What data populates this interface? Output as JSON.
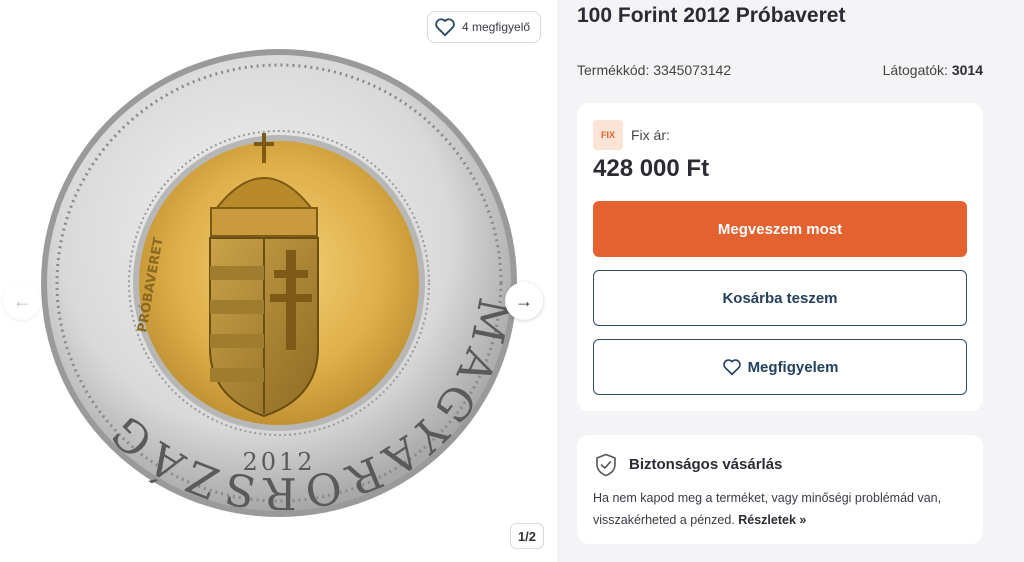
{
  "gallery": {
    "watch_count_label": "4 megfigyelő",
    "prev_arrow": "←",
    "next_arrow": "→",
    "counter": "1/2",
    "coin": {
      "ring_text": "MAGYARORSZÁG",
      "year": "2012",
      "side_text": "PRÓBAVERET"
    }
  },
  "product": {
    "title": "100 Forint 2012 Próbaveret",
    "code_label": "Termékkód:",
    "code_value": "3345073142",
    "visitors_label": "Látogatók:",
    "visitors_value": "3014"
  },
  "buy": {
    "badge": "FIX",
    "price_type": "Fix ár:",
    "price": "428 000 Ft",
    "buy_now": "Megveszem most",
    "add_to_cart": "Kosárba teszem",
    "watch": "Megfigyelem"
  },
  "safe": {
    "title": "Biztonságos vásárlás",
    "text": "Ha nem kapod meg a terméket, vagy minőségi problémád van, visszakérheted a pénzed.",
    "link": "Részletek »"
  },
  "colors": {
    "accent": "#e3622f",
    "navy": "#24415e",
    "badge_bg": "#fbe3d6"
  }
}
